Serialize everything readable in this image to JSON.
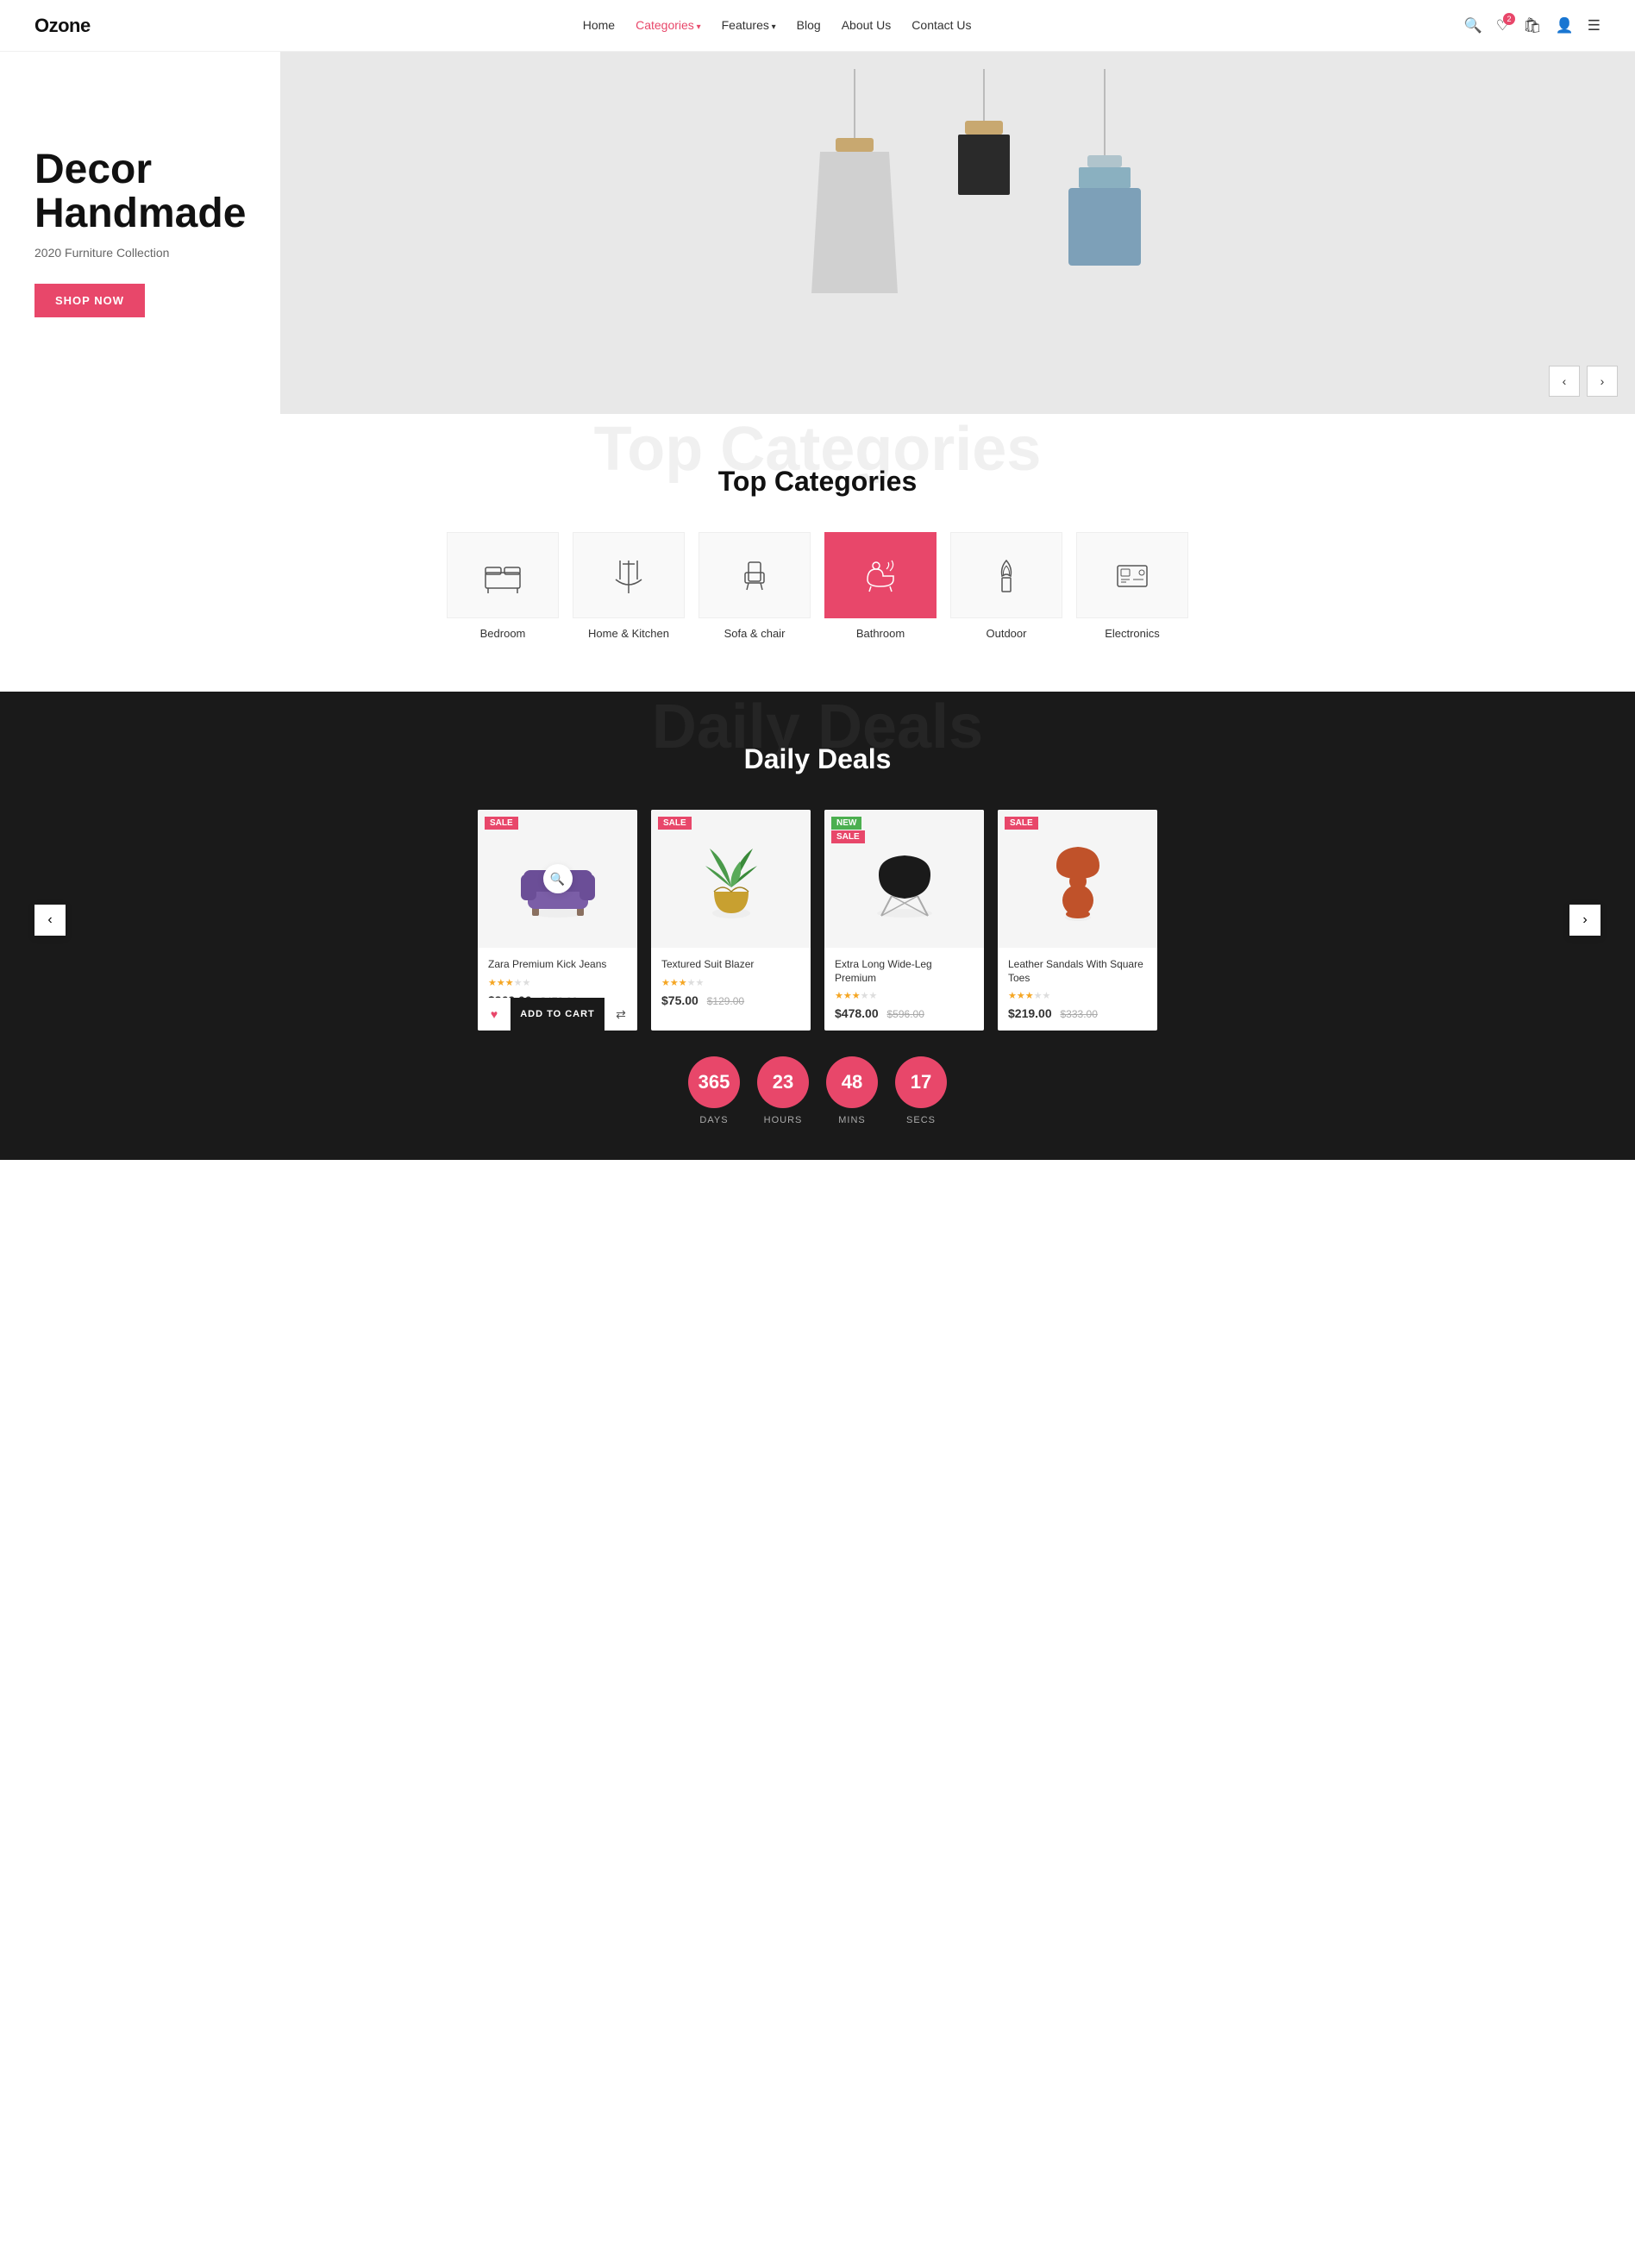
{
  "brand": "Ozone",
  "nav": {
    "links": [
      {
        "label": "Home",
        "active": false
      },
      {
        "label": "Categories",
        "active": true,
        "hasArrow": true
      },
      {
        "label": "Features",
        "active": false,
        "hasArrow": true
      },
      {
        "label": "Blog",
        "active": false
      },
      {
        "label": "About Us",
        "active": false
      },
      {
        "label": "Contact Us",
        "active": false
      }
    ],
    "wishlist_count": "2"
  },
  "hero": {
    "title": "Decor\nHandmade",
    "subtitle": "2020 Furniture Collection",
    "cta": "SHOP NOW"
  },
  "top_categories": {
    "bg_text": "Top Categories",
    "title": "Top Categories",
    "items": [
      {
        "label": "Bedroom",
        "icon": "🛏",
        "active": false
      },
      {
        "label": "Home & Kitchen",
        "icon": "🍴",
        "active": false
      },
      {
        "label": "Sofa & chair",
        "icon": "🪑",
        "active": false
      },
      {
        "label": "Bathroom",
        "icon": "🛁",
        "active": true
      },
      {
        "label": "Outdoor",
        "icon": "🌿",
        "active": false
      },
      {
        "label": "Electronics",
        "icon": "📺",
        "active": false
      }
    ]
  },
  "daily_deals": {
    "bg_text": "Daily Deals",
    "title": "Daily Deals",
    "products": [
      {
        "name": "Zara Premium Kick Jeans",
        "badge": "SALE",
        "badge_type": "sale",
        "price": "$369.00",
        "original_price": "$478.00",
        "stars": 3,
        "emoji": "🪑",
        "color": "#7b5ea7"
      },
      {
        "name": "Textured Suit Blazer",
        "badge": "SALE",
        "badge_type": "sale",
        "price": "$75.00",
        "original_price": "$129.00",
        "stars": 3,
        "emoji": "🪴",
        "color": "#5a8a5a"
      },
      {
        "name": "Extra Long Wide-Leg Premium",
        "badge": "NEW",
        "badge2": "SALE",
        "badge_type": "new",
        "price": "$478.00",
        "original_price": "$596.00",
        "stars": 3,
        "emoji": "🪑",
        "color": "#1a1a1a"
      },
      {
        "name": "Leather Sandals With Square Toes",
        "badge": "SALE",
        "badge_type": "sale",
        "price": "$219.00",
        "original_price": "$333.00",
        "stars": 3,
        "emoji": "💡",
        "color": "#c0522a"
      }
    ],
    "countdown": [
      {
        "value": "365",
        "label": "DAYS"
      },
      {
        "value": "23",
        "label": "HOURS"
      },
      {
        "value": "48",
        "label": "MINS"
      },
      {
        "value": "17",
        "label": "SECS"
      }
    ]
  },
  "icons": {
    "search": "🔍",
    "wishlist": "♡",
    "cart": "🛍",
    "user": "👤",
    "menu": "☰",
    "arrow_left": "‹",
    "arrow_right": "›",
    "compare": "⇄",
    "heart_filled": "♥"
  }
}
